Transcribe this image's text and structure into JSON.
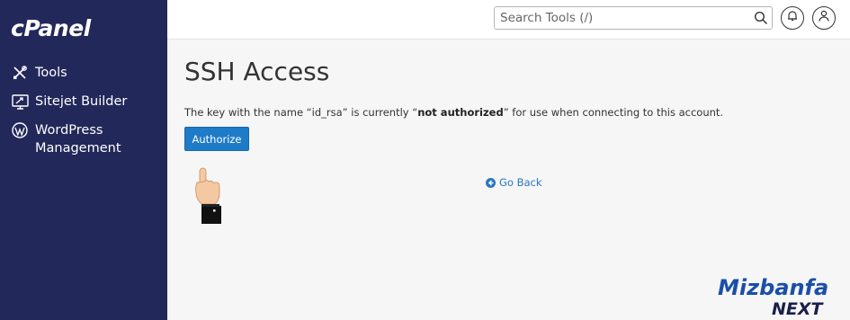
{
  "sidebar": {
    "logo": "cPanel",
    "items": [
      {
        "label": "Tools",
        "icon": "tools-icon"
      },
      {
        "label": "Sitejet Builder",
        "icon": "sitejet-icon"
      },
      {
        "label": "WordPress\nManagement",
        "icon": "wordpress-icon"
      }
    ]
  },
  "header": {
    "search_placeholder": "Search Tools (/)",
    "search_icon": "search-icon",
    "notifications_icon": "bell-icon",
    "user_icon": "user-icon"
  },
  "main": {
    "title": "SSH Access",
    "message_prefix": "The key with the name “id_rsa” is currently “",
    "message_bold": "not authorized",
    "message_suffix": "” for use when connecting to this account.",
    "authorize_label": "Authorize",
    "go_back_label": "Go Back"
  },
  "watermark": {
    "line1": "Mizbanfa",
    "line2": "NEXT"
  },
  "colors": {
    "sidebar_bg": "#23285a",
    "button_blue": "#1e7bc8",
    "link_blue": "#2a76c0",
    "background": "#f6f6f6"
  }
}
